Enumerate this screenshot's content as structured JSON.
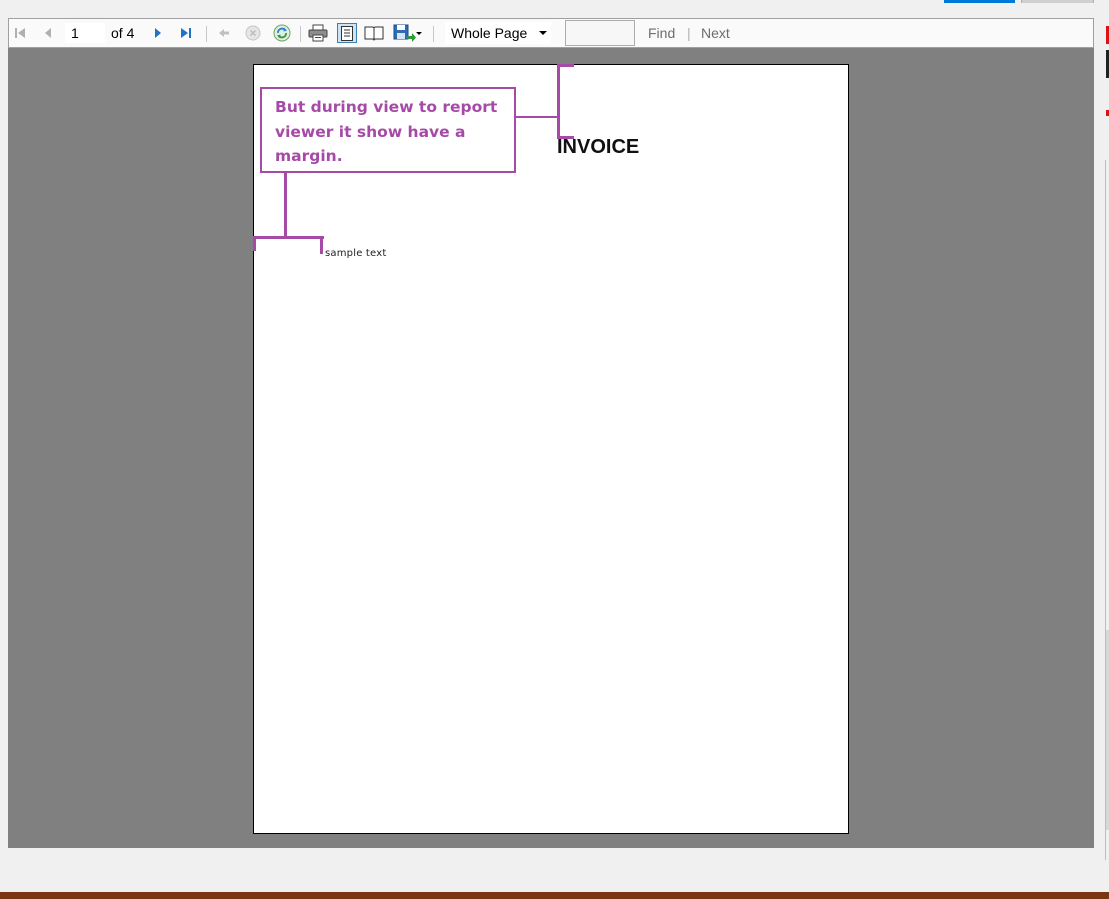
{
  "toolbar": {
    "page_number": "1",
    "of_label": "of",
    "total_pages": "4",
    "zoom_value": "Whole Page",
    "find_label": "Find",
    "find_separator": "|",
    "next_label": "Next",
    "icons": [
      "first-page-icon",
      "previous-page-icon",
      "next-page-icon",
      "last-page-icon",
      "back-to-parent-icon",
      "stop-icon",
      "refresh-icon",
      "print-icon",
      "print-layout-icon",
      "page-setup-icon",
      "export-icon"
    ]
  },
  "report": {
    "title": "INVOICE",
    "sample_text": "sample text"
  },
  "annotation": {
    "text": "But during view to report viewer it show have a margin."
  },
  "colors": {
    "annotation": "#a64aa8",
    "viewport_background": "#808080",
    "nav_arrow": "#1e73c8"
  }
}
